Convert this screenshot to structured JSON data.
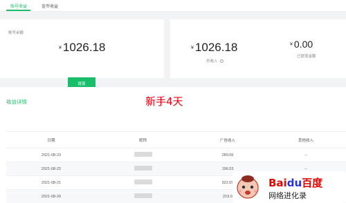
{
  "tabs": [
    {
      "label": "账号收益",
      "active": true
    },
    {
      "label": "金币收益",
      "active": false
    }
  ],
  "account": {
    "label": "账号余额",
    "currency": "¥",
    "amount": "1026.18",
    "button_label": "提现"
  },
  "summary": {
    "total_currency": "¥",
    "total_amount": "1026.18",
    "total_label": "总收入",
    "withdrawn_currency": "¥",
    "withdrawn_amount": "0.00",
    "withdrawn_label": "已提现金额"
  },
  "detail": {
    "title": "收益详情",
    "overlay": "新手4天"
  },
  "table": {
    "headers": [
      "日期",
      "昵称",
      "广告收入",
      "其他收入"
    ],
    "rows": [
      {
        "date": "2021-08-23",
        "ad": "289.06",
        "other": "--"
      },
      {
        "date": "2021-08-22",
        "ad": "196.03",
        "other": "--"
      },
      {
        "date": "2021-08-21",
        "ad": "322.05",
        "other": ""
      },
      {
        "date": "2021-08-20",
        "ad": "219.0",
        "other": ""
      }
    ]
  },
  "watermark": {
    "logo_bai": "Bai",
    "logo_du": "du",
    "logo_cn": "百度",
    "subtitle": "网络进化录"
  },
  "colors": {
    "accent": "#19be6b",
    "overlay_red": "#e60012",
    "baidu_red": "#e10602",
    "baidu_blue": "#2932e1"
  }
}
